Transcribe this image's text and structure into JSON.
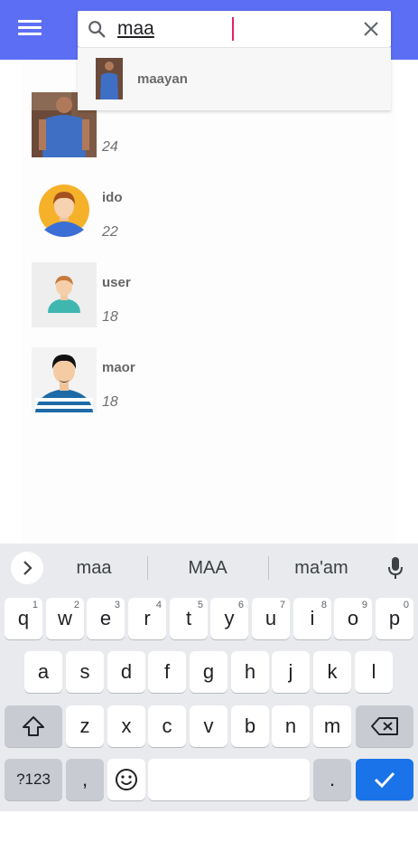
{
  "search": {
    "value": "maa"
  },
  "suggestion": {
    "label": "maayan"
  },
  "users": [
    {
      "name": "maayan",
      "age": "24"
    },
    {
      "name": "ido",
      "age": "22"
    },
    {
      "name": "user",
      "age": "18"
    },
    {
      "name": "maor",
      "age": "18"
    }
  ],
  "keyboard": {
    "suggestions": [
      "maa",
      "MAA",
      "ma'am"
    ],
    "row1": [
      {
        "label": "q",
        "hint": "1"
      },
      {
        "label": "w",
        "hint": "2"
      },
      {
        "label": "e",
        "hint": "3"
      },
      {
        "label": "r",
        "hint": "4"
      },
      {
        "label": "t",
        "hint": "5"
      },
      {
        "label": "y",
        "hint": "6"
      },
      {
        "label": "u",
        "hint": "7"
      },
      {
        "label": "i",
        "hint": "8"
      },
      {
        "label": "o",
        "hint": "9"
      },
      {
        "label": "p",
        "hint": "0"
      }
    ],
    "row2": [
      "a",
      "s",
      "d",
      "f",
      "g",
      "h",
      "j",
      "k",
      "l"
    ],
    "row3": [
      "z",
      "x",
      "c",
      "v",
      "b",
      "n",
      "m"
    ],
    "symbols_label": "?123",
    "comma_label": ",",
    "period_label": "."
  },
  "colors": {
    "appbar": "#5c6ef4",
    "enter_key": "#1a73e8",
    "caret": "#e91e63"
  }
}
